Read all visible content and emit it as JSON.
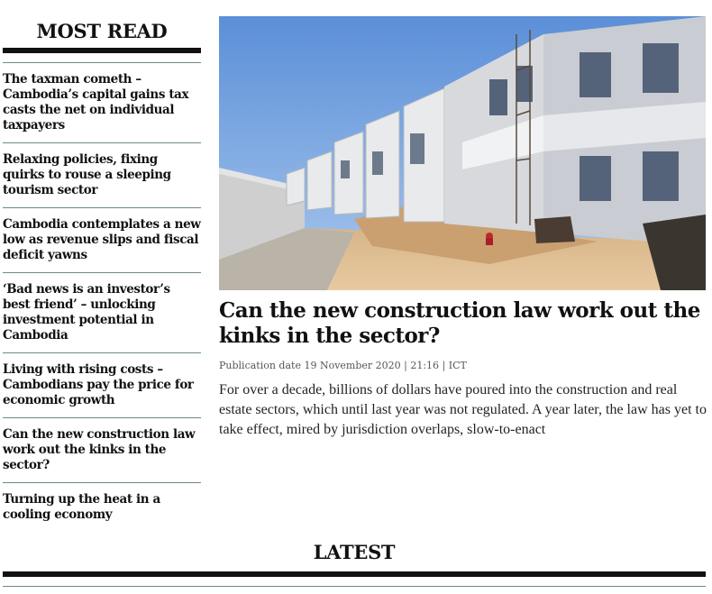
{
  "most_read": {
    "title": "MOST READ",
    "items": [
      {
        "label": "The taxman cometh – Cambodia’s capital gains tax casts the net on individual taxpayers"
      },
      {
        "label": "Relaxing policies, fixing quirks to rouse a sleeping tourism sector"
      },
      {
        "label": "Cambodia contemplates a new low as revenue slips and fiscal deficit yawns"
      },
      {
        "label": "‘Bad news is an investor’s best friend’ – unlocking investment potential in Cambodia"
      },
      {
        "label": "Living with rising costs – Cambodians pay the price for economic growth"
      },
      {
        "label": "Can the new construction law work out the kinks in the sector?"
      },
      {
        "label": "Turning up the heat in a cooling economy"
      }
    ]
  },
  "article": {
    "headline": "Can the new construction law work out the kinks in the sector?",
    "publication_date": "Publication date 19 November 2020 | 21:16 | ICT",
    "excerpt": "For over a decade, billions of dollars have poured into the construction and real estate sectors, which until last year was not regulated. A year later, the law has yet to take effect, mired by jurisdiction overlaps, slow-to-enact"
  },
  "latest": {
    "title": "LATEST"
  }
}
